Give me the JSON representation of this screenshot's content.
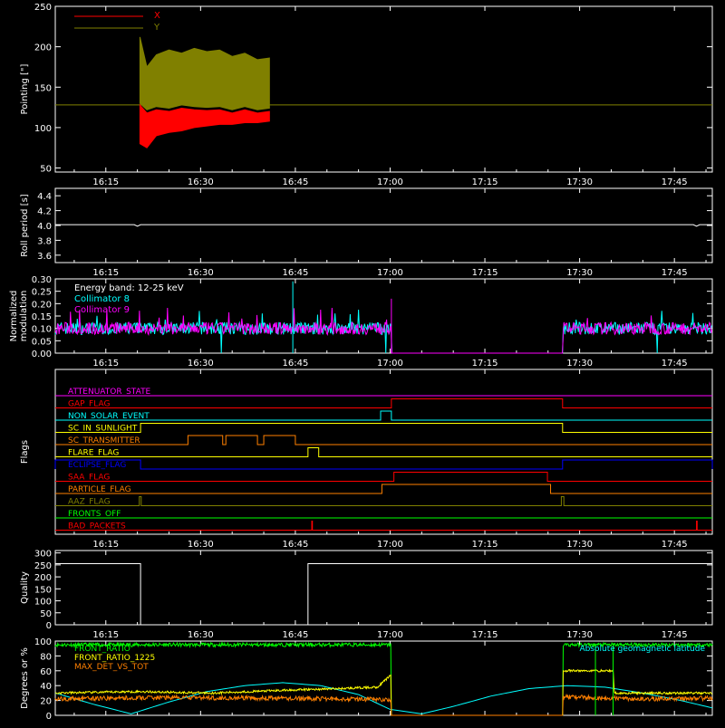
{
  "time_ticks": [
    "16:15",
    "16:30",
    "16:45",
    "17:00",
    "17:15",
    "17:30",
    "17:45"
  ],
  "time_tick_minutes": [
    975,
    990,
    1005,
    1020,
    1035,
    1050,
    1065
  ],
  "time_range_minutes": [
    967,
    1071
  ],
  "chart_data": [
    {
      "type": "area",
      "ylabel": "Pointing [\"]",
      "ylim": [
        45,
        250
      ],
      "yticks": [
        50,
        100,
        150,
        200,
        250
      ],
      "ytick_labels": [
        "50",
        "100",
        "150",
        "200",
        "250"
      ],
      "legend": [
        {
          "name": "X",
          "color": "#ff0000"
        },
        {
          "name": "Y",
          "color": "#808000"
        }
      ],
      "legend_placement": "top-left",
      "baseline": 128,
      "baseline_color": "#808000",
      "band_time_range": [
        980.4,
        1000.9
      ],
      "series": [
        {
          "name": "Y",
          "color": "#808000",
          "t": [
            980.4,
            981.5,
            983,
            985,
            987,
            989,
            991,
            993,
            995,
            997,
            999,
            1000.9
          ],
          "upper": [
            212,
            175,
            190,
            196,
            192,
            198,
            194,
            196,
            188,
            192,
            184,
            186
          ],
          "lower": [
            130,
            122,
            126,
            124,
            128,
            126,
            125,
            126,
            122,
            126,
            122,
            124
          ]
        },
        {
          "name": "X",
          "color": "#ff0000",
          "t": [
            980.4,
            981.5,
            983,
            985,
            987,
            989,
            991,
            993,
            995,
            997,
            999,
            1000.9
          ],
          "upper": [
            128,
            118,
            122,
            120,
            124,
            122,
            121,
            122,
            118,
            122,
            118,
            120
          ],
          "lower": [
            80,
            75,
            90,
            94,
            96,
            100,
            102,
            104,
            104,
            106,
            106,
            108
          ]
        }
      ]
    },
    {
      "type": "line",
      "ylabel": "Roll period [s]",
      "ylim": [
        3.5,
        4.5
      ],
      "yticks": [
        3.6,
        3.8,
        4.0,
        4.2,
        4.4
      ],
      "ytick_labels": [
        "3.6",
        "3.8",
        "4.0",
        "4.2",
        "4.4"
      ],
      "series": [
        {
          "color": "#ffffff",
          "t": [
            967,
            1071
          ],
          "y": [
            4.01,
            4.01
          ]
        }
      ]
    },
    {
      "type": "line",
      "ylabel": "Normalized modulation",
      "ylim": [
        0,
        0.3
      ],
      "yticks": [
        0,
        0.05,
        0.1,
        0.15,
        0.2,
        0.25,
        0.3
      ],
      "ytick_labels": [
        "0.00",
        "0.05",
        "0.10",
        "0.15",
        "0.20",
        "0.25",
        "0.30"
      ],
      "legend_title": "Energy band: 12-25 keV",
      "legend": [
        {
          "name": "Collimator 8",
          "color": "#00ffff"
        },
        {
          "name": "Collimator 9",
          "color": "#ff00ff"
        }
      ],
      "legend_placement": "top-left",
      "active_ranges": [
        [
          967,
          1020.2
        ],
        [
          1047.3,
          1071
        ]
      ],
      "mean": 0.1
    },
    {
      "type": "line",
      "ylabel": "Flags",
      "flags": [
        {
          "name": "ATTENUATOR_STATE",
          "color": "#ff00ff",
          "on": []
        },
        {
          "name": "GAP_FLAG",
          "color": "#ff0000",
          "on": [
            [
              1020.2,
              1047.3
            ]
          ]
        },
        {
          "name": "NON_SOLAR_EVENT",
          "color": "#00ffff",
          "on": [
            [
              1018.5,
              1020.2
            ]
          ]
        },
        {
          "name": "SC_IN_SUNLIGHT",
          "color": "#ffff00",
          "on": [
            [
              980.5,
              1047.3
            ]
          ]
        },
        {
          "name": "SC_TRANSMITTER",
          "color": "#ff8000",
          "on": [
            [
              988,
              993.5
            ],
            [
              994,
              999
            ],
            [
              1000,
              1005
            ]
          ]
        },
        {
          "name": "FLARE_FLAG",
          "color": "#ffff00",
          "on": [
            [
              1007,
              1008.7
            ]
          ]
        },
        {
          "name": "ECLIPSE_FLAG",
          "color": "#0000ff",
          "on": [
            [
              967,
              980.5
            ],
            [
              1047.3,
              1071
            ]
          ]
        },
        {
          "name": "SAA_FLAG",
          "color": "#ff0000",
          "on": [
            [
              1020.6,
              1044.9
            ]
          ]
        },
        {
          "name": "PARTICLE_FLAG",
          "color": "#ff8000",
          "on": [
            [
              1018.7,
              1045.4
            ]
          ]
        },
        {
          "name": "AAZ_FLAG",
          "color": "#808000",
          "on": [
            [
              980.3,
              980.6
            ],
            [
              1047.1,
              1047.5
            ]
          ]
        },
        {
          "name": "FRONTS_OFF",
          "color": "#00ff00",
          "on": []
        },
        {
          "name": "BAD_PACKETS",
          "color": "#ff0000",
          "on": [
            [
              1007.6,
              1007.7
            ],
            [
              1068.5,
              1068.6
            ]
          ]
        }
      ]
    },
    {
      "type": "line",
      "ylabel": "Quality",
      "ylim": [
        0,
        310
      ],
      "yticks": [
        0,
        50,
        100,
        150,
        200,
        250,
        300
      ],
      "ytick_labels": [
        "0",
        "50",
        "100",
        "150",
        "200",
        "250",
        "300"
      ],
      "series": [
        {
          "color": "#ffffff",
          "t": [
            967,
            980.5,
            980.5,
            1007,
            1007,
            1071
          ],
          "y": [
            255,
            255,
            0,
            0,
            255,
            255
          ]
        }
      ]
    },
    {
      "type": "line",
      "ylabel": "Degrees or %",
      "ylim": [
        0,
        100
      ],
      "yticks": [
        0,
        20,
        40,
        60,
        80,
        100
      ],
      "ytick_labels": [
        "0",
        "20",
        "40",
        "60",
        "80",
        "100"
      ],
      "legend": [
        {
          "name": "FRONT_RATIO",
          "color": "#00ff00"
        },
        {
          "name": "FRONT_RATIO_1225",
          "color": "#ffff00"
        },
        {
          "name": "MAX_DET_VS_TOT",
          "color": "#ff8000"
        }
      ],
      "annotation": {
        "text": "Absolute geomagnetic latitude",
        "color": "#00ffff"
      },
      "series": [
        {
          "name": "Absolute geomagnetic latitude",
          "color": "#00ffff",
          "t": [
            967,
            973,
            979,
            985,
            991,
            997,
            1003,
            1009,
            1015,
            1020,
            1025,
            1030,
            1036,
            1042,
            1048,
            1054,
            1060,
            1066,
            1071
          ],
          "y": [
            30,
            15,
            2,
            18,
            32,
            40,
            44,
            40,
            28,
            8,
            2,
            12,
            26,
            36,
            40,
            38,
            30,
            20,
            10
          ]
        },
        {
          "name": "FRONT_RATIO",
          "color": "#00ff00",
          "t": [
            967,
            1020.2,
            1020.2,
            1047.3,
            1047.3,
            1071
          ],
          "y": [
            95,
            95,
            0,
            0,
            95,
            95
          ]
        },
        {
          "name": "FRONT_RATIO_1225",
          "color": "#ffff00",
          "t": [
            967,
            980,
            992,
            1004,
            1012,
            1018,
            1020.2,
            1020.2,
            1047.3,
            1047.3,
            1055.3,
            1055.5,
            1071
          ],
          "y": [
            30,
            32,
            30,
            34,
            36,
            38,
            55,
            0,
            0,
            60,
            60,
            30,
            30
          ]
        },
        {
          "name": "MAX_DET_VS_TOT",
          "color": "#ff8000",
          "t": [
            967,
            985,
            1000,
            1015,
            1020.2,
            1020.2,
            1047.3,
            1047.3,
            1060,
            1071
          ],
          "y": [
            22,
            24,
            23,
            22,
            21,
            0,
            0,
            25,
            22,
            23
          ]
        }
      ]
    }
  ]
}
